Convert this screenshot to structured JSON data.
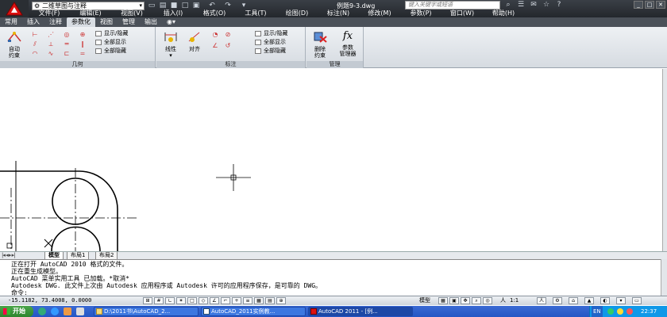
{
  "title_bar": {
    "workspace": "二维草图与注释",
    "doc_title": "例题9-3.dwg",
    "search_placeholder": "键入关键字或短语"
  },
  "menu": [
    "文件(F)",
    "编辑(E)",
    "视图(V)",
    "插入(I)",
    "格式(O)",
    "工具(T)",
    "绘图(D)",
    "标注(N)",
    "修改(M)",
    "参数(P)",
    "窗口(W)",
    "帮助(H)"
  ],
  "ribbon_tabs": [
    "常用",
    "插入",
    "注释",
    "参数化",
    "视图",
    "管理",
    "输出"
  ],
  "active_tab": "参数化",
  "ribbon": {
    "geometry_panel": {
      "label": "几何",
      "auto_constrain": [
        "自动",
        "约束"
      ],
      "show_hide": "显示/隐藏",
      "show_all": "全部显示",
      "hide_all": "全部隐藏"
    },
    "dimension_panel": {
      "label": "标注",
      "linear": "线性",
      "aligned": "对齐",
      "show_hide": "显示/隐藏",
      "show_all": "全部显示",
      "hide_all": "全部隐藏"
    },
    "manage_panel": {
      "label": "管理",
      "delete_constraints": [
        "删除",
        "约束"
      ],
      "param_manager": [
        "参数",
        "管理器"
      ],
      "fx": "fx"
    }
  },
  "layout_tabs": [
    "模型",
    "布局1",
    "布局2"
  ],
  "command_history": [
    "正在打开 AutoCAD 2010 格式的文件。",
    "正在重生成模型。",
    "AutoCAD 菜单实用工具 已加载。*取消*",
    "Autodesk DWG.  此文件上次由 Autodesk 应用程序或 Autodesk 许可的应用程序保存，是可靠的 DWG。"
  ],
  "command_prompt": "命令:",
  "status": {
    "coords": "-15.1182, 73.4008, 0.0000",
    "model_label": "模型",
    "annotation_scale": "1:1"
  },
  "taskbar": {
    "start": "开始",
    "buttons": [
      "D:\\2011书\\AutoCAD_2...",
      "AutoCAD_2011实例教...",
      "AutoCAD 2011 - [例..."
    ],
    "clock": "22:37",
    "language": "EN"
  }
}
